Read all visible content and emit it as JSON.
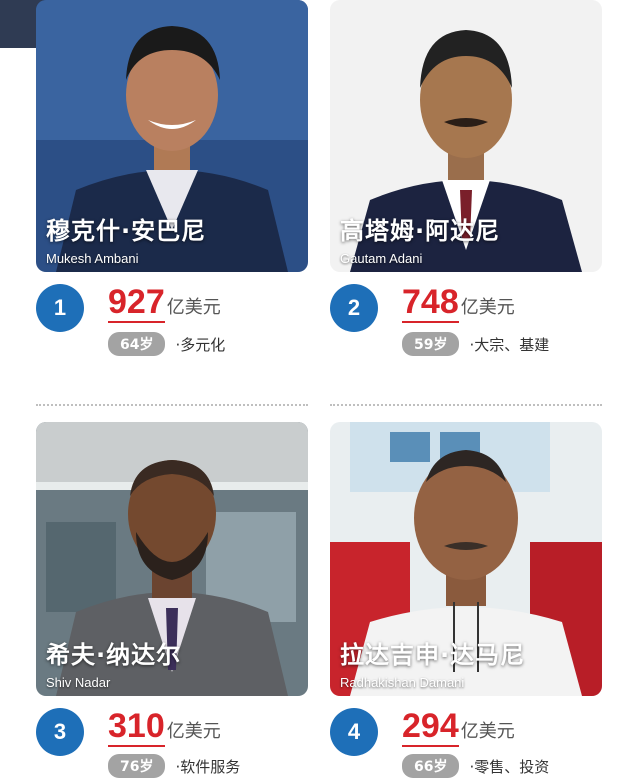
{
  "people": [
    {
      "rank": "1",
      "name_cn": "穆克什·安巴尼",
      "name_en": "Mukesh Ambani",
      "worth": "927",
      "unit": "亿美元",
      "age": "64岁",
      "industry": "·多元化"
    },
    {
      "rank": "2",
      "name_cn": "高塔姆·阿达尼",
      "name_en": "Gautam Adani",
      "worth": "748",
      "unit": "亿美元",
      "age": "59岁",
      "industry": "·大宗、基建"
    },
    {
      "rank": "3",
      "name_cn": "希夫·纳达尔",
      "name_en": "Shiv Nadar",
      "worth": "310",
      "unit": "亿美元",
      "age": "76岁",
      "industry": "·软件服务"
    },
    {
      "rank": "4",
      "name_cn": "拉达吉申·达马尼",
      "name_en": "Radhakishan Damani",
      "worth": "294",
      "unit": "亿美元",
      "age": "66岁",
      "industry": "·零售、投资"
    }
  ],
  "colors": {
    "rank_badge": "#1e6fb8",
    "worth": "#d8242a",
    "age_badge": "#a3a3a3"
  }
}
